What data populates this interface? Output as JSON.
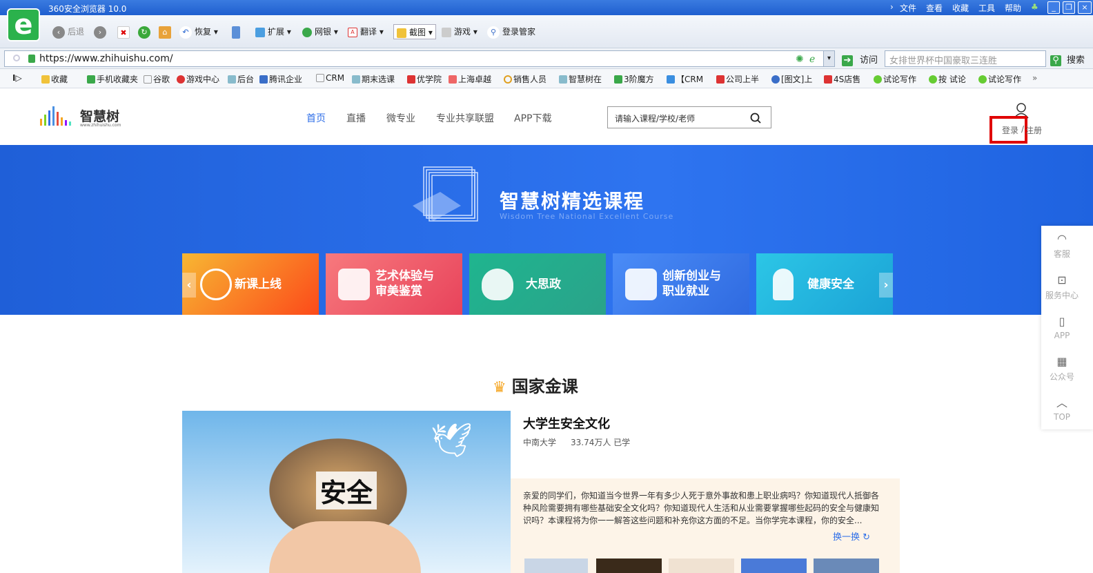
{
  "browser": {
    "title": "360安全浏览器 10.0",
    "menu": [
      "文件",
      "查看",
      "收藏",
      "工具",
      "帮助"
    ],
    "toolbar": {
      "back": "后退",
      "restore": "恢复",
      "extend": "扩展",
      "bank": "网银",
      "translate": "翻译",
      "screenshot": "截图",
      "games": "游戏",
      "login_mgr": "登录管家"
    },
    "url": "https://www.zhihuishu.com/",
    "visit": "访问",
    "search_placeholder": "女排世界杯中国豪取三连胜",
    "search_btn": "搜索",
    "bookmarks": [
      "收藏",
      "手机收藏夹",
      "谷歌",
      "游戏中心",
      "后台",
      "腾讯企业",
      "CRM",
      "期末选课",
      "优学院",
      "上海卓越",
      "销售人员",
      "智慧树在",
      "3阶魔方",
      "【CRM",
      "公司上半",
      "[图文]上",
      "4S店售",
      "试论写作",
      "按 试论",
      "试论写作"
    ]
  },
  "site": {
    "logo_text": "智慧树",
    "logo_sub": "www.zhihuishu.com",
    "nav": [
      "首页",
      "直播",
      "微专业",
      "专业共享联盟",
      "APP下载"
    ],
    "search_placeholder": "请输入课程/学校/老师",
    "login": "登录",
    "register": "注册",
    "sep": "/"
  },
  "hero": {
    "title": "智慧树精选课程",
    "subtitle": "Wisdom Tree National Excellent Course",
    "categories": [
      {
        "l1": "新课上线",
        "l2": ""
      },
      {
        "l1": "艺术体验与",
        "l2": "审美鉴赏"
      },
      {
        "l1": "大思政",
        "l2": ""
      },
      {
        "l1": "创新创业与",
        "l2": "职业就业"
      },
      {
        "l1": "健康安全",
        "l2": ""
      }
    ]
  },
  "sidebar": [
    "客服",
    "服务中心",
    "APP",
    "公众号",
    "TOP"
  ],
  "gold": {
    "title": "国家金课",
    "course_title": "大学生安全文化",
    "school": "中南大学",
    "learners": "33.74万人 已学",
    "image_text": "安全",
    "desc": "亲爱的同学们，你知道当今世界一年有多少人死于意外事故和患上职业病吗？你知道现代人抵御各种风险需要拥有哪些基础安全文化吗？你知道现代人生活和从业需要掌握哪些起码的安全与健康知识吗？本课程将为你一一解答这些问题和补充你这方面的不足。当你学完本课程，你的安全...",
    "switch": "换一换"
  },
  "colors": {
    "accent": "#2f6fe8",
    "highlight": "#e00000"
  }
}
